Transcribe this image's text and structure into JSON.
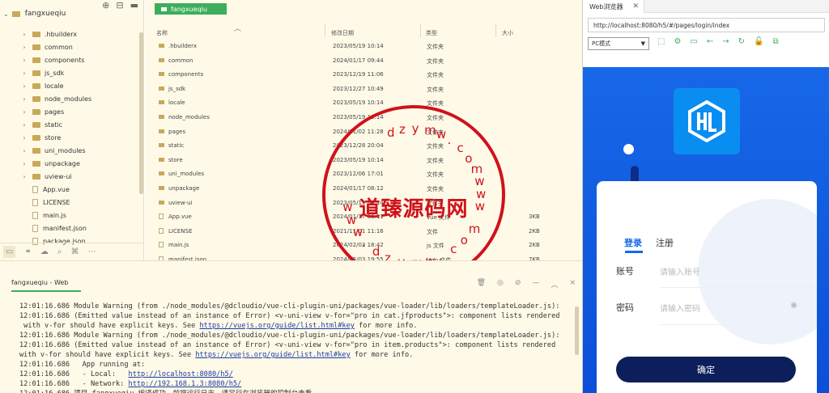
{
  "project": {
    "name": "fangxueqiu",
    "tree": [
      {
        "label": ".hbuilderx",
        "type": "folder"
      },
      {
        "label": "common",
        "type": "folder"
      },
      {
        "label": "components",
        "type": "folder"
      },
      {
        "label": "js_sdk",
        "type": "folder"
      },
      {
        "label": "locale",
        "type": "folder"
      },
      {
        "label": "node_modules",
        "type": "folder"
      },
      {
        "label": "pages",
        "type": "folder"
      },
      {
        "label": "static",
        "type": "folder"
      },
      {
        "label": "store",
        "type": "folder"
      },
      {
        "label": "uni_modules",
        "type": "folder"
      },
      {
        "label": "unpackage",
        "type": "folder"
      },
      {
        "label": "uview-ui",
        "type": "folder"
      },
      {
        "label": "App.vue",
        "type": "file"
      },
      {
        "label": "LICENSE",
        "type": "file"
      },
      {
        "label": "main.js",
        "type": "file"
      },
      {
        "label": "manifest.json",
        "type": "file"
      },
      {
        "label": "package.json",
        "type": "file"
      }
    ]
  },
  "filelist": {
    "breadcrumb": "fangxueqiu",
    "headers": {
      "name": "名称",
      "date": "修改日期",
      "type": "类型",
      "size": "大小"
    },
    "rows": [
      {
        "name": ".hbuilderx",
        "date": "2023/05/19 10:14",
        "type": "文件夹",
        "size": "",
        "kind": "folder"
      },
      {
        "name": "common",
        "date": "2024/01/17 09:44",
        "type": "文件夹",
        "size": "",
        "kind": "folder"
      },
      {
        "name": "components",
        "date": "2023/12/19 11:06",
        "type": "文件夹",
        "size": "",
        "kind": "folder"
      },
      {
        "name": "js_sdk",
        "date": "2023/12/27 10:49",
        "type": "文件夹",
        "size": "",
        "kind": "folder"
      },
      {
        "name": "locale",
        "date": "2023/05/19 10:14",
        "type": "文件夹",
        "size": "",
        "kind": "folder"
      },
      {
        "name": "node_modules",
        "date": "2023/05/19 10:14",
        "type": "文件夹",
        "size": "",
        "kind": "folder"
      },
      {
        "name": "pages",
        "date": "2024/01/02 11:28",
        "type": "文件夹",
        "size": "",
        "kind": "folder"
      },
      {
        "name": "static",
        "date": "2023/12/28 20:04",
        "type": "文件夹",
        "size": "",
        "kind": "folder"
      },
      {
        "name": "store",
        "date": "2023/05/19 10:14",
        "type": "文件夹",
        "size": "",
        "kind": "folder"
      },
      {
        "name": "uni_modules",
        "date": "2023/12/06 17:01",
        "type": "文件夹",
        "size": "",
        "kind": "folder"
      },
      {
        "name": "unpackage",
        "date": "2024/01/17 08:12",
        "type": "文件夹",
        "size": "",
        "kind": "folder"
      },
      {
        "name": "uview-ui",
        "date": "2023/05/19 10:14",
        "type": "文件夹",
        "size": "",
        "kind": "folder"
      },
      {
        "name": "App.vue",
        "date": "2024/01/17 08:11",
        "type": "vue 文件",
        "size": "3KB",
        "kind": "file"
      },
      {
        "name": "LICENSE",
        "date": "2021/11/01 11:16",
        "type": "文件",
        "size": "2KB",
        "kind": "file"
      },
      {
        "name": "main.js",
        "date": "2024/02/03 18:42",
        "type": "js 文件",
        "size": "2KB",
        "kind": "file"
      },
      {
        "name": "manifest.json",
        "date": "2024/02/03 19:55",
        "type": "json 文件",
        "size": "7KB",
        "kind": "file"
      }
    ]
  },
  "stamp": {
    "center_text": "道臻源码网",
    "arc_top": [
      "d",
      "z",
      "y",
      "m",
      "w",
      ".",
      "c",
      "o",
      "m",
      "w",
      "w",
      "w"
    ],
    "arc_bottom": [
      "w",
      "w",
      "w",
      ".",
      "d",
      "z",
      "y",
      "m",
      "w",
      ".",
      "c",
      "o",
      "m"
    ]
  },
  "console": {
    "tab_label": "fangxueqiu - Web",
    "lines": [
      {
        "text": "12:01:16.686 Module Warning (from ./node_modules/@dcloudio/vue-cli-plugin-uni/packages/vue-loader/lib/loaders/templateLoader.js):",
        "link": ""
      },
      {
        "text": "12:01:16.686 (Emitted value instead of an instance of Error) <v-uni-view v-for=\"pro in cat.jfproducts\">: component lists rendered",
        "link": ""
      },
      {
        "text": " with v-for should have explicit keys. See ",
        "link": "https://vuejs.org/guide/list.html#key",
        "after": " for more info."
      },
      {
        "text": "12:01:16.686 Module Warning (from ./node_modules/@dcloudio/vue-cli-plugin-uni/packages/vue-loader/lib/loaders/templateLoader.js):",
        "link": ""
      },
      {
        "text": "12:01:16.686 (Emitted value instead of an instance of Error) <v-uni-view v-for=\"pro in item.products\">: component lists rendered",
        "link": ""
      },
      {
        "text": "with v-for should have explicit keys. See ",
        "link": "https://vuejs.org/guide/list.html#key",
        "after": " for more info."
      },
      {
        "text": "12:01:16.686   App running at:",
        "link": ""
      },
      {
        "text": "12:01:16.686   - Local:   ",
        "link": "http://localhost:8080/h5/",
        "after": ""
      },
      {
        "text": "12:01:16.686   - Network: ",
        "link": "http://192.168.1.3:8080/h5/",
        "after": ""
      },
      {
        "text": "12:01:16.686 项目 fangxueqiu 编译成功。前端运行日志，请另行在浏览器的控制台查看。",
        "link": ""
      }
    ]
  },
  "browser": {
    "tab_title": "Web浏览器",
    "url": "http://localhost:8080/h5/#/pages/login/index",
    "mode": "PC模式",
    "login": {
      "tab_login": "登录",
      "tab_register": "注册",
      "account_label": "账号",
      "account_placeholder": "请输入账号",
      "password_label": "密码",
      "password_placeholder": "请输入密码",
      "submit": "确定"
    },
    "colors": {
      "accent": "#1768e8",
      "button": "#0c1f5a",
      "green": "#3cae5c"
    }
  }
}
